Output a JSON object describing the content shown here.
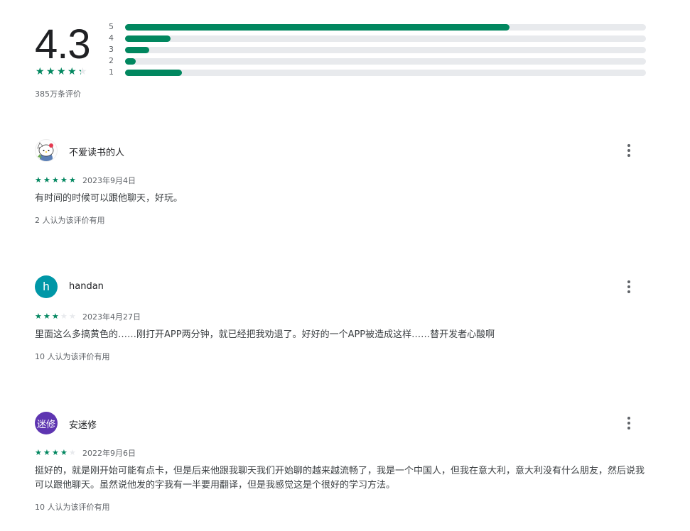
{
  "summary": {
    "rating": "4.3",
    "rating_value": 4.3,
    "review_count": "385万条评价",
    "distribution": [
      {
        "label": "5",
        "fraction": 0.738
      },
      {
        "label": "4",
        "fraction": 0.087
      },
      {
        "label": "3",
        "fraction": 0.047
      },
      {
        "label": "2",
        "fraction": 0.02
      },
      {
        "label": "1",
        "fraction": 0.109
      }
    ]
  },
  "colors": {
    "accent": "#01875f",
    "track": "#e8eaed",
    "muted": "#5f6368"
  },
  "reviews": [
    {
      "name": "不爱读书的人",
      "avatar": {
        "type": "image",
        "icon": "hello-kitty-avatar-icon"
      },
      "stars": 5,
      "date": "2023年9月4日",
      "text": "有时间的时候可以跟他聊天，好玩。",
      "helpful": "2 人认为该评价有用"
    },
    {
      "name": "handan",
      "avatar": {
        "type": "initial",
        "text": "h",
        "color": "#0097a7"
      },
      "stars": 3,
      "date": "2023年4月27日",
      "text": "里面这么多搞黄色的……刚打开APP两分钟，就已经把我劝退了。好好的一个APP被造成这样……替开发者心酸啊",
      "helpful": "10 人认为该评价有用"
    },
    {
      "name": "安迷修",
      "avatar": {
        "type": "initial",
        "text": "迷修",
        "color": "#5e35b1"
      },
      "stars": 4,
      "date": "2022年9月6日",
      "text": "挺好的，就是刚开始可能有点卡，但是后来他跟我聊天我们开始聊的越来越流畅了，我是一个中国人，但我在意大利，意大利没有什么朋友，然后说我可以跟他聊天。虽然说他发的字我有一半要用翻译，但是我感觉这是个很好的学习方法。",
      "helpful": "10 人认为该评价有用"
    }
  ]
}
